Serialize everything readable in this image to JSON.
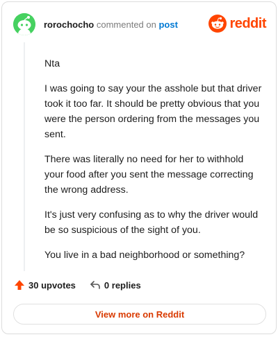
{
  "header": {
    "username": "rorochocho",
    "action_text": "commented on",
    "post_link": "post",
    "brand": "reddit"
  },
  "comment": {
    "paragraphs": [
      "Nta",
      "I was going to say your the asshole but that driver took it too far. It should be pretty obvious that you were the person ordering from the messages you sent.",
      "There was literally no need for her to withhold your food after you sent the message correcting the wrong address.",
      "It's just very confusing as to why the driver would be so suspicious of the sight of you.",
      "You live in a bad neighborhood or something?"
    ]
  },
  "footer": {
    "upvotes": "30 upvotes",
    "replies": "0 replies"
  },
  "button": {
    "label": "View more on Reddit"
  },
  "colors": {
    "brand": "#ff4500",
    "link": "#0079d3",
    "button_text": "#d93a00",
    "avatar_bg": "#46d160"
  },
  "icons": {
    "avatar": "snoo-avatar-icon",
    "brand": "reddit-logo-icon",
    "upvote": "upvote-arrow-icon",
    "reply": "reply-arrow-icon"
  }
}
